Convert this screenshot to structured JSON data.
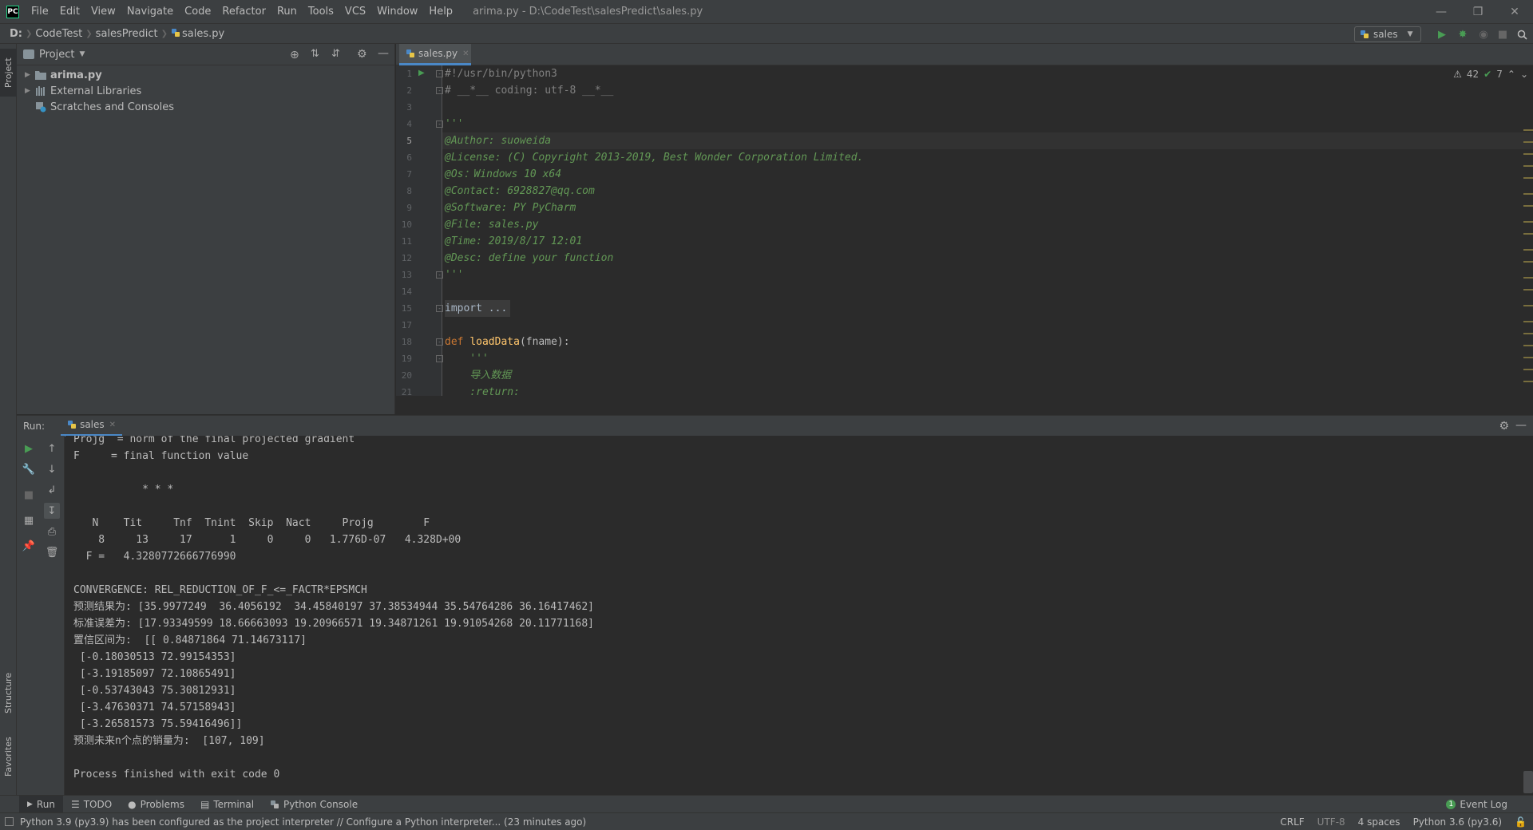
{
  "title_bar": {
    "logo_text": "PC",
    "menu": [
      "File",
      "Edit",
      "View",
      "Navigate",
      "Code",
      "Refactor",
      "Run",
      "Tools",
      "VCS",
      "Window",
      "Help"
    ],
    "window_title": "arima.py - D:\\CodeTest\\salesPredict\\sales.py"
  },
  "nav_bar": {
    "breadcrumbs": [
      "D:",
      "CodeTest",
      "salesPredict",
      "sales.py"
    ],
    "run_config": "sales"
  },
  "left_stripe": {
    "project_tab": "Project",
    "structure_tab": "Structure",
    "favorites_tab": "Favorites"
  },
  "project_panel": {
    "title": "Project",
    "items": [
      {
        "label": "arima.py",
        "type": "file"
      },
      {
        "label": "External Libraries",
        "type": "library"
      },
      {
        "label": "Scratches and Consoles",
        "type": "scratch"
      }
    ]
  },
  "editor": {
    "tab_label": "sales.py",
    "inspection_warnings": "42",
    "inspection_ok": "7",
    "lines": [
      {
        "n": "1",
        "text": "#!/usr/bin/python3",
        "cls": "cmt"
      },
      {
        "n": "2",
        "text": "# __*__ coding: utf-8 __*__",
        "cls": "cmt"
      },
      {
        "n": "3",
        "text": "",
        "cls": ""
      },
      {
        "n": "4",
        "text": "'''",
        "cls": "doc"
      },
      {
        "n": "5",
        "text": "@Author: suoweida",
        "cls": "doc"
      },
      {
        "n": "6",
        "text": "@License: (C) Copyright 2013-2019, Best Wonder Corporation Limited.",
        "cls": "doc"
      },
      {
        "n": "7",
        "text": "@Os：Windows 10 x64",
        "cls": "doc"
      },
      {
        "n": "8",
        "text": "@Contact: 6928827@qq.com",
        "cls": "doc"
      },
      {
        "n": "9",
        "text": "@Software: PY PyCharm",
        "cls": "doc"
      },
      {
        "n": "10",
        "text": "@File: sales.py",
        "cls": "doc"
      },
      {
        "n": "11",
        "text": "@Time: 2019/8/17 12:01",
        "cls": "doc"
      },
      {
        "n": "12",
        "text": "@Desc: define your function",
        "cls": "doc"
      },
      {
        "n": "13",
        "text": "'''",
        "cls": "doc"
      },
      {
        "n": "14",
        "text": "",
        "cls": ""
      },
      {
        "n": "15",
        "text": "import ...",
        "cls": "cmt"
      },
      {
        "n": "17",
        "text": "",
        "cls": ""
      },
      {
        "n": "18",
        "text": "def loadData(fname):",
        "cls": "def"
      },
      {
        "n": "19",
        "text": "    '''",
        "cls": "doc"
      },
      {
        "n": "20",
        "text": "    导入数据",
        "cls": "doc"
      },
      {
        "n": "21",
        "text": "    :return:",
        "cls": "doc"
      }
    ]
  },
  "run_panel": {
    "label": "Run:",
    "tab": "sales",
    "console": [
      "Projg  = norm of the final projected gradient",
      "F     = final function value",
      "",
      "           * * *",
      "",
      "   N    Tit     Tnf  Tnint  Skip  Nact     Projg        F",
      "    8     13     17      1     0     0   1.776D-07   4.328D+00",
      "  F =   4.3280772666776990",
      "",
      "CONVERGENCE: REL_REDUCTION_OF_F_<=_FACTR*EPSMCH",
      "预测结果为: [35.9977249  36.4056192  34.45840197 37.38534944 35.54764286 36.16417462]",
      "标准误差为: [17.93349599 18.66663093 19.20966571 19.34871261 19.91054268 20.11771168]",
      "置信区间为:  [[ 0.84871864 71.14673117]",
      " [-0.18030513 72.99154353]",
      " [-3.19185097 72.10865491]",
      " [-0.53743043 75.30812931]",
      " [-3.47630371 74.57158943]",
      " [-3.26581573 75.59416496]]",
      "预测未来n个点的销量为:  [107, 109]",
      "",
      "Process finished with exit code 0"
    ]
  },
  "bottom_tools": {
    "run": "Run",
    "todo": "TODO",
    "problems": "Problems",
    "terminal": "Terminal",
    "python_console": "Python Console",
    "event_log": "Event Log",
    "event_log_count": "1"
  },
  "status_bar": {
    "message": "Python 3.9 (py3.9) has been configured as the project interpreter // Configure a Python interpreter... (23 minutes ago)",
    "line_sep": "CRLF",
    "encoding": "UTF-8",
    "indent": "4 spaces",
    "interpreter": "Python 3.6 (py3.6)"
  },
  "colors": {
    "accent": "#4a88c7",
    "run_green": "#499c54",
    "doc_green": "#629755",
    "keyword": "#cc7832",
    "function": "#ffc66d"
  }
}
